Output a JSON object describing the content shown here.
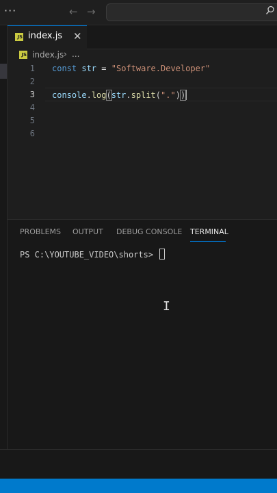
{
  "titlebar": {
    "menu_icon": "more-horizontal-icon",
    "back_icon": "arrow-left-icon",
    "forward_icon": "arrow-right-icon",
    "search_placeholder": "",
    "search_icon": "search-icon",
    "more_glyph": "···",
    "back_glyph": "←",
    "forward_glyph": "→"
  },
  "tab": {
    "label": "index.js",
    "badge": "JS",
    "close_glyph": "✕"
  },
  "breadcrumb": {
    "file": "index.js",
    "separator": "›",
    "more": "..."
  },
  "editor": {
    "line_numbers": [
      "1",
      "2",
      "3",
      "4",
      "5",
      "6"
    ],
    "active_line": 3,
    "line1": {
      "keyword": "const",
      "var": "str",
      "op": "=",
      "string": "\"Software.Developer\""
    },
    "line3": {
      "obj": "console",
      "dot1": ".",
      "fn": "log",
      "open": "(",
      "arg": "str",
      "dot2": ".",
      "method": "split",
      "inner_open": "(",
      "string": "\".\"",
      "inner_close": ")",
      "close": ")"
    }
  },
  "panel": {
    "tabs": [
      "PROBLEMS",
      "OUTPUT",
      "DEBUG CONSOLE",
      "TERMINAL"
    ],
    "active_tab": "TERMINAL",
    "terminal_prompt": "PS C:\\YOUTUBE_VIDEO\\shorts> "
  },
  "colors": {
    "accent": "#007acc",
    "js_badge": "#cbcb41",
    "background": "#1e1e1e"
  }
}
